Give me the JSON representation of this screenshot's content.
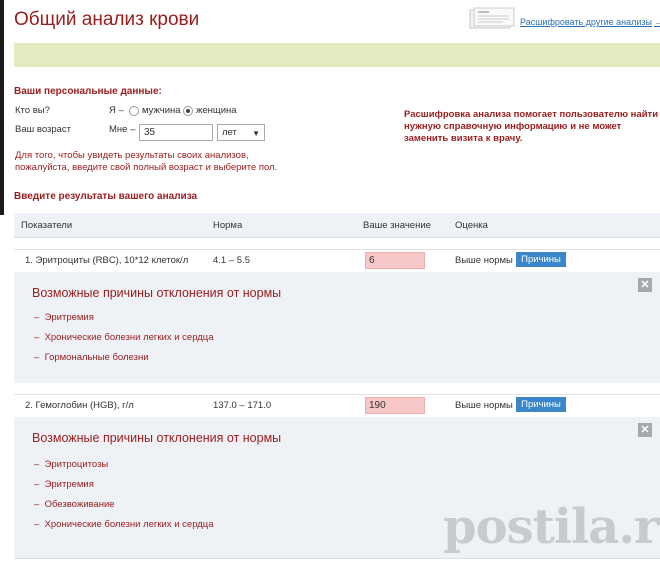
{
  "header": {
    "title": "Общий анализ крови",
    "decode_link": "Расшифровать другие анализы",
    "arrow": "→"
  },
  "personal": {
    "title": "Ваши персональные данные:",
    "who_label": "Кто вы?",
    "who_prefix": "Я –",
    "gender_options": [
      "мужчина",
      "женщина"
    ],
    "gender_selected": "женщина",
    "age_label": "Ваш возраст",
    "age_prefix": "Мне –",
    "age_value": "35",
    "age_unit": "лет",
    "hint": "Для того, чтобы увидеть результаты своих анализов, пожалуйста, введите свой полный возраст и выберите пол.",
    "note": "Расшифровка анализа помогает пользователю найти нужную справочную информацию и не может заменить визита к врачу."
  },
  "results": {
    "title": "Введите результаты вашего анализа",
    "columns": [
      "Показатели",
      "Норма",
      "Ваше значение",
      "Оценка"
    ],
    "rows": [
      {
        "name": "1.  Эритроциты (RBC), 10*12 клеток/л",
        "norm": "4.1 – 5.5",
        "value": "6",
        "assessment": "Выше нормы",
        "reasons_button": "Причины",
        "panel_title": "Возможные причины отклонения от нормы",
        "reasons": [
          "Эритремия",
          "Хронические болезни легких и сердца",
          "Гормональные болезни"
        ]
      },
      {
        "name": "2.  Гемоглобин (HGB), г/л",
        "norm": "137.0 – 171.0",
        "value": "190",
        "assessment": "Выше нормы",
        "reasons_button": "Причины",
        "panel_title": "Возможные причины отклонения от нормы",
        "reasons": [
          "Эритроцитозы",
          "Эритремия",
          "Обезвоживание",
          "Хронические болезни легких и сердца"
        ]
      }
    ]
  },
  "watermark": "postila.ru",
  "colors": {
    "accent": "#9b1c1c",
    "link": "#2a6fb4",
    "button": "#3a86c8",
    "band": "#e3ebc0",
    "panel": "#eef2f6",
    "value_bg": "#f7c6c6"
  }
}
